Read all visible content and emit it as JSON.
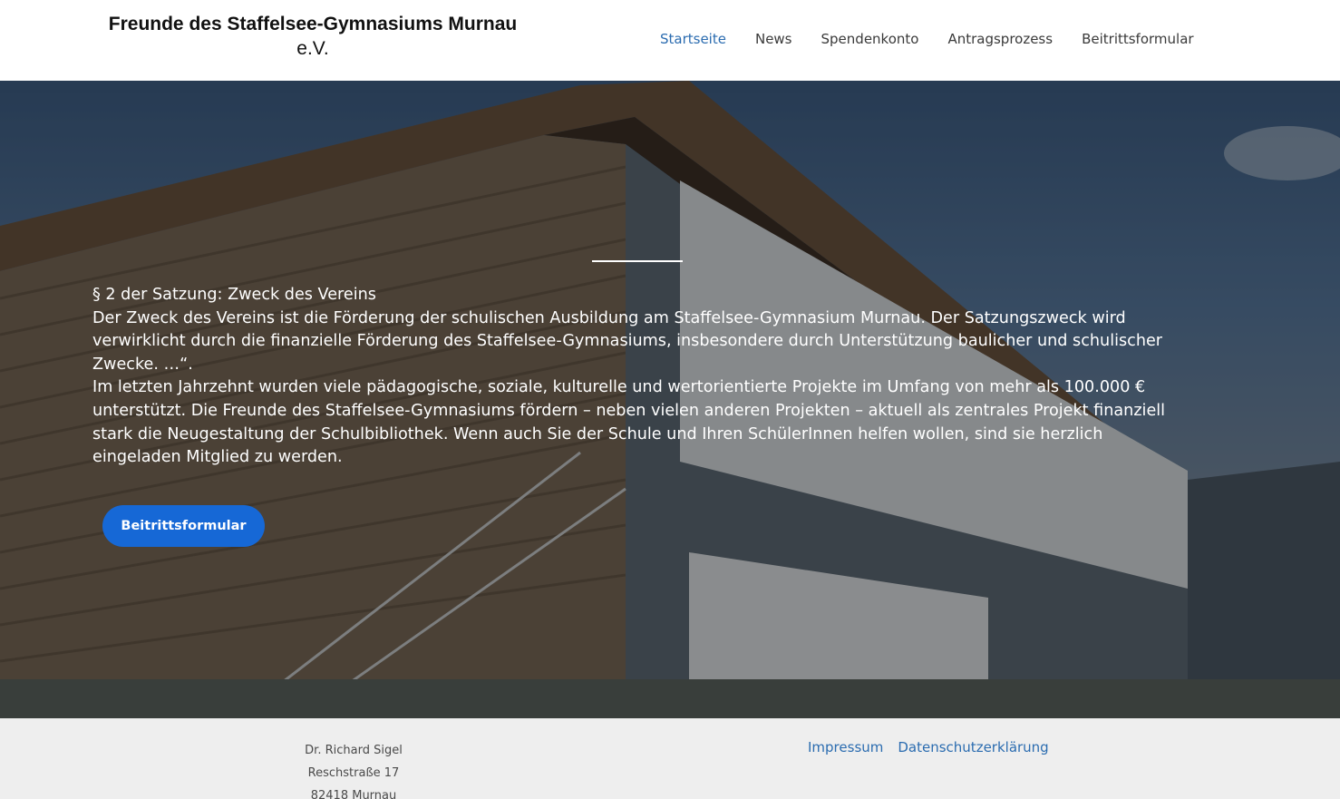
{
  "header": {
    "logo_line1": "Freunde des Staffelsee-Gymnasiums Murnau",
    "logo_line2": "e.V.",
    "nav": [
      {
        "label": "Startseite",
        "active": true
      },
      {
        "label": "News"
      },
      {
        "label": "Spendenkonto"
      },
      {
        "label": "Antragsprozess"
      },
      {
        "label": "Beitrittsformular"
      }
    ]
  },
  "hero": {
    "heading": "§ 2 der Satzung: Zweck des Vereins",
    "paragraph1": "Der Zweck des Vereins ist die Förderung der schulischen Ausbildung am Staffelsee-Gymnasium Murnau. Der Satzungszweck wird verwirklicht durch die finanzielle Förderung des Staffelsee-Gymnasiums, insbesondere durch Unterstützung baulicher und schulischer Zwecke. …“.",
    "paragraph2": "Im letzten Jahrzehnt wurden viele pädagogische, soziale, kulturelle und wertorientierte Projekte im Umfang von mehr als 100.000 € unterstützt. Die Freunde des Staffelsee-Gymnasiums fördern – neben vielen anderen Projekten – aktuell als zentrales Projekt finanziell stark die Neugestaltung der Schulbibliothek. Wenn auch Sie der Schule und Ihren SchülerInnen helfen wollen, sind sie herzlich eingeladen Mitglied zu werden.",
    "cta_label": "Beitrittsformular"
  },
  "footer": {
    "address": [
      "Dr. Richard Sigel",
      "Reschstraße 17",
      "82418 Murnau"
    ],
    "links": [
      "Impressum",
      "Datenschutzerklärung"
    ]
  },
  "colors": {
    "accent": "#2b6cb0",
    "button": "#1668d6",
    "footer_bg": "#eeeeee"
  }
}
